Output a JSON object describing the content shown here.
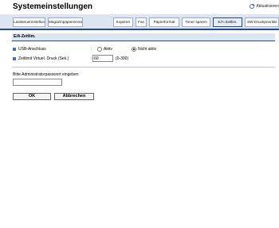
{
  "page_title": "Systemeinstellungen",
  "refresh_label": "Aktualisieren",
  "tabs": [
    {
      "label": "Laststeuerinstellung",
      "active": false
    },
    {
      "label": "Magazinpapiereinstell.",
      "active": false
    },
    {
      "label": "Kopierer",
      "active": false
    },
    {
      "label": "Fax",
      "active": false
    },
    {
      "label": "Papierformat",
      "active": false
    },
    {
      "label": "Toner sparen",
      "active": false
    },
    {
      "label": "E/A-Zeitlim.",
      "active": true
    },
    {
      "label": "SW-Druckpriorität",
      "active": false
    }
  ],
  "section_title": "E/A-Zeitlim.",
  "usb": {
    "label": "USB-Anschluss",
    "colon": ":",
    "option_on": "Aktiv",
    "option_off": "Nicht aktiv",
    "selected": "Nicht aktiv"
  },
  "timeout": {
    "label": "Zeitlimit Virtuel. Druck (Sek.)",
    "colon": ":",
    "value": "60",
    "range": "(0-300)"
  },
  "password": {
    "label": "Bitte Administratorpasswort eingeben",
    "value": ""
  },
  "buttons": {
    "ok": "OK",
    "cancel": "Abbrechen"
  },
  "colors": {
    "accent": "#1e4c8c",
    "tab_bar": "#dde6f0",
    "bullet": "#4b6fb0"
  },
  "icons": [
    "refresh-icon",
    "bullet-icon",
    "radio-icon"
  ]
}
